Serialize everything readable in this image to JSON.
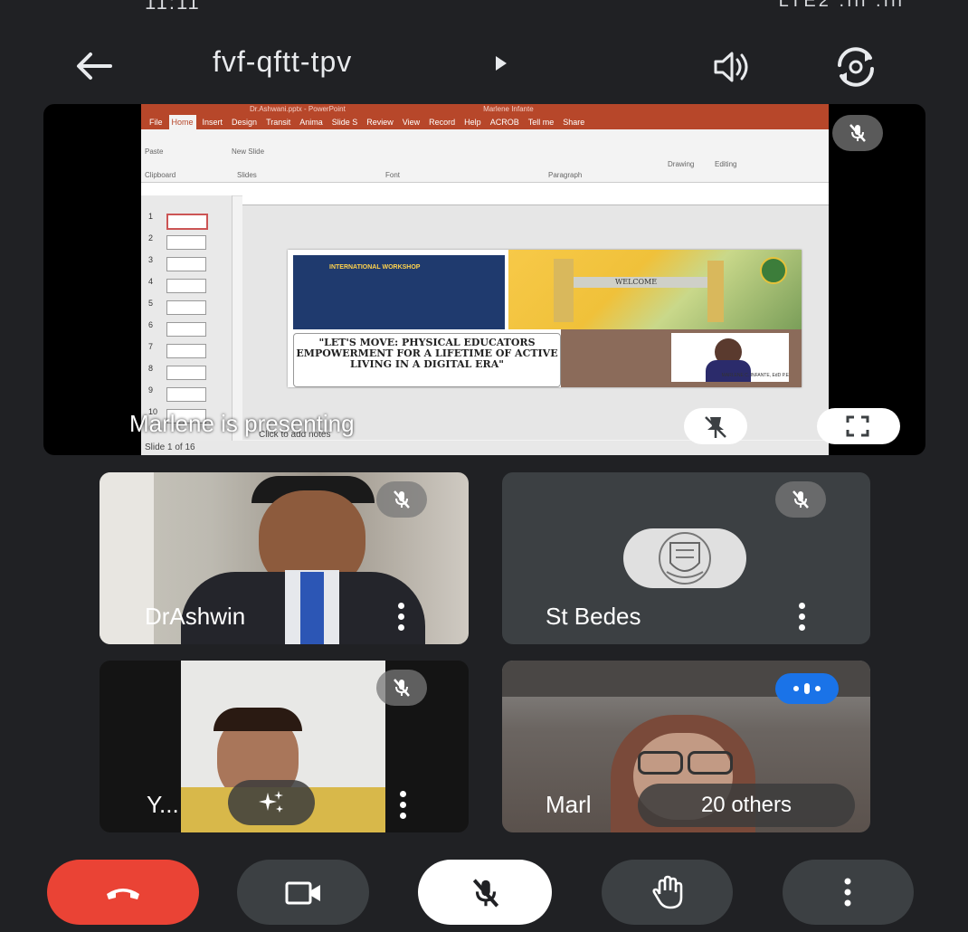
{
  "status_bar": {
    "left": "11:11",
    "right": "LTE2 .ıll .ıll"
  },
  "header": {
    "meeting_code": "fvf-qftt-tpv"
  },
  "presentation": {
    "presenting_label": "Marlene is presenting",
    "ppt": {
      "window_title": "Dr.Ashwani.pptx - PowerPoint",
      "user": "Marlene Infante",
      "tabs": [
        "File",
        "Home",
        "Insert",
        "Design",
        "Transit",
        "Anima",
        "Slide S",
        "Review",
        "View",
        "Record",
        "Help",
        "ACROB",
        "Tell me",
        "Share"
      ],
      "ribbon_groups": [
        "Clipboard",
        "Slides",
        "Font",
        "Paragraph",
        "Drawing",
        "Editing"
      ],
      "ribbon_buttons": [
        "Paste",
        "New Slide"
      ],
      "thumbnail_numbers": [
        "1",
        "2",
        "3",
        "4",
        "5",
        "6",
        "7",
        "8",
        "9",
        "10"
      ],
      "notes_placeholder": "Click to add notes",
      "status": "Slide 1 of 16",
      "slide": {
        "banner_title": "INTERNATIONAL WORKSHOP",
        "quote": "\"LET'S MOVE: PHYSICAL EDUCATORS EMPOWERMENT FOR A LIFETIME OF ACTIVE LIVING IN A DIGITAL ERA\"",
        "welcome_sign": "WELCOME",
        "speaker_caption": "MARLENE C. INFANTE, EdD P.E"
      }
    }
  },
  "participants": [
    {
      "name": "DrAshwin",
      "muted": true
    },
    {
      "name": "St Bedes",
      "muted": true
    },
    {
      "name": "Y...",
      "muted": true
    },
    {
      "name": "Marl",
      "others_label": "20 others",
      "speaking": true
    }
  ],
  "controls": [
    "end-call",
    "camera",
    "microphone",
    "raise-hand",
    "more-options"
  ],
  "colors": {
    "background": "#202124",
    "tile": "#3c4043",
    "end_call": "#ea4335",
    "speaking": "#1a73e8",
    "ppt_accent": "#b7472a"
  }
}
